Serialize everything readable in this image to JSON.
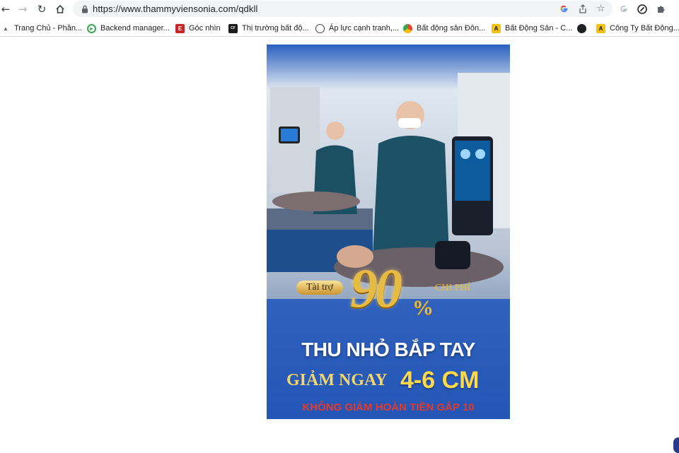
{
  "browser": {
    "url": "https://www.thammyviensonia.com/qdkll",
    "icons": {
      "back": "arrow-left-icon",
      "forward": "arrow-right-icon",
      "reload": "reload-icon",
      "home": "home-icon",
      "lock": "lock-icon",
      "google": "google-icon",
      "share": "share-icon",
      "bookmark": "star-icon",
      "profile": "profile-icon",
      "extension_link": "link-icon",
      "extensions": "puzzle-icon"
    }
  },
  "bookmarks": [
    {
      "label": "Trang Chủ - Phần...",
      "icon": "triangle-icon",
      "color": "#5f6368"
    },
    {
      "label": "Backend manager...",
      "icon": "gear-icon",
      "color": "#34a853"
    },
    {
      "label": "Góc nhìn",
      "icon": "e-icon",
      "color": "#c62828"
    },
    {
      "label": "Thị trường bất độ...",
      "icon": "cafef-icon",
      "color": "#1b1b1b"
    },
    {
      "label": "Áp lực cạnh tranh,...",
      "icon": "circle-icon",
      "color": "#3c4043"
    },
    {
      "label": "Bất động sản Đôn...",
      "icon": "chrome-icon",
      "color": "#ea4335"
    },
    {
      "label": "Bất Động Sản - C...",
      "icon": "ai-icon",
      "color": "#f4c20d"
    },
    {
      "label": "",
      "icon": "globe-icon",
      "color": "#202124"
    },
    {
      "label": "Công Ty Bất Động...",
      "icon": "ai-icon",
      "color": "#f4c20d"
    }
  ],
  "banner": {
    "sponsor": "Tài trợ",
    "percent_number": "90",
    "percent_sign": "%",
    "cost_label": "CHI PHÍ",
    "headline": "THU NHỎ BẮP TAY",
    "reduce_label": "GIẢM NGAY",
    "reduce_value": "4-6 CM",
    "guarantee": "KHÔNG GIẢM HOÀN TIỀN GẤP 10"
  }
}
